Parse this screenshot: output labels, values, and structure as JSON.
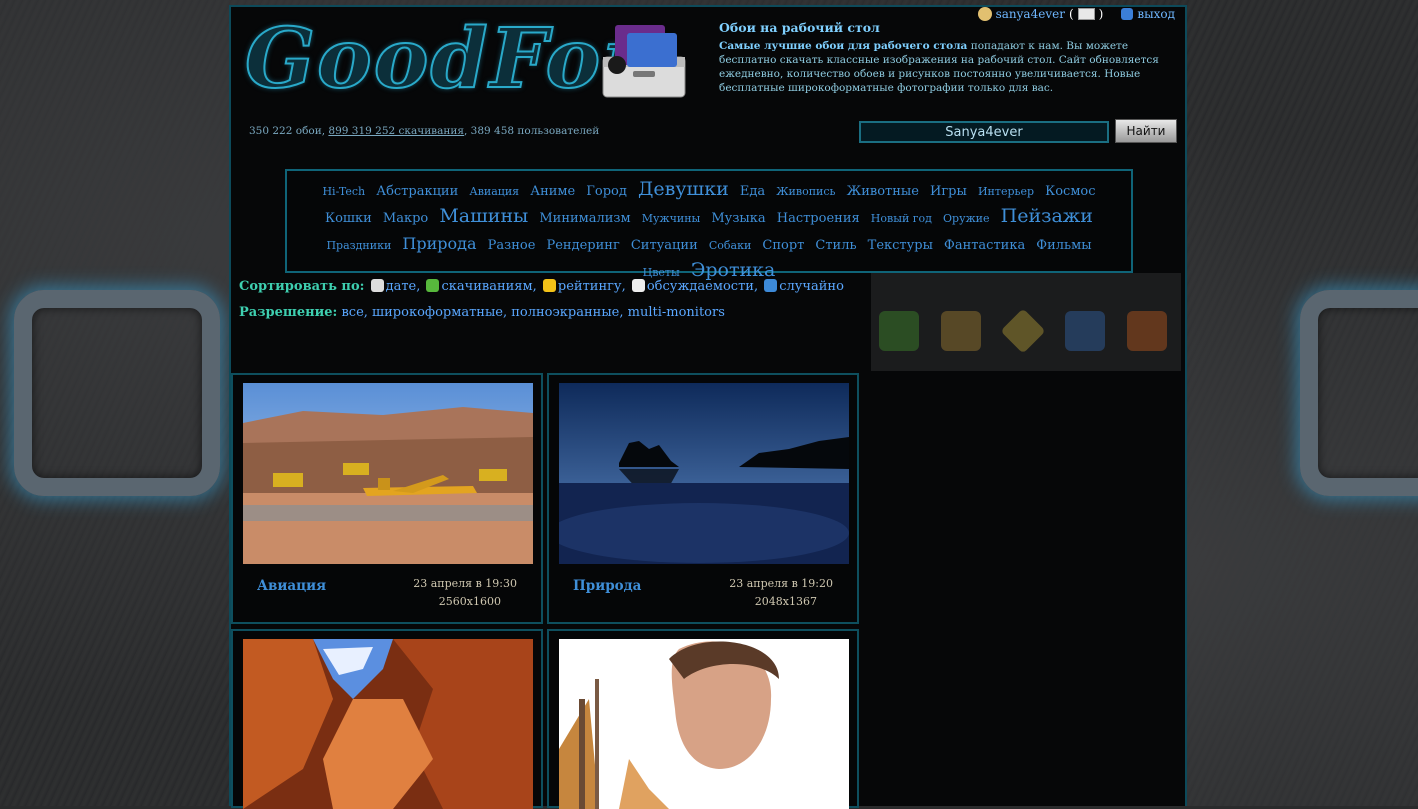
{
  "header": {
    "logo_text": "GoodFon",
    "user": {
      "name": "sanya4ever",
      "open_paren": "(",
      "close_paren": ")",
      "logout_label": "выход"
    },
    "intro": {
      "title": "Обои на рабочий стол",
      "bold_lead": "Самые лучшие обои для рабочего стола",
      "text": " попадают к нам. Вы можете бесплатно скачать классные изображения на рабочий стол. Сайт обновляется ежедневно, количество обоев и рисунков постоянно увеличивается. Новые бесплатные широкоформатные фотографии только для вас."
    },
    "stats": {
      "walls": "350 222 обои, ",
      "downloads": "899 319 252 скачивания",
      "users": ", 389 458 пользователей"
    },
    "search": {
      "value": "Sanya4ever",
      "button_label": "Найти"
    }
  },
  "tags": [
    {
      "label": "Hi-Tech",
      "size": "s1"
    },
    {
      "label": "Абстракции",
      "size": "s2"
    },
    {
      "label": "Авиация",
      "size": "s1"
    },
    {
      "label": "Аниме",
      "size": "s2"
    },
    {
      "label": "Город",
      "size": "s2"
    },
    {
      "label": "Девушки",
      "size": "s4"
    },
    {
      "label": "Еда",
      "size": "s2"
    },
    {
      "label": "Живопись",
      "size": "s1"
    },
    {
      "label": "Животные",
      "size": "s2"
    },
    {
      "label": "Игры",
      "size": "s2"
    },
    {
      "label": "Интерьер",
      "size": "s1"
    },
    {
      "label": "Космос",
      "size": "s2"
    },
    {
      "label": "Кошки",
      "size": "s2"
    },
    {
      "label": "Макро",
      "size": "s2"
    },
    {
      "label": "Машины",
      "size": "s4"
    },
    {
      "label": "Минимализм",
      "size": "s2"
    },
    {
      "label": "Мужчины",
      "size": "s1"
    },
    {
      "label": "Музыка",
      "size": "s2"
    },
    {
      "label": "Настроения",
      "size": "s2"
    },
    {
      "label": "Новый год",
      "size": "s1"
    },
    {
      "label": "Оружие",
      "size": "s1"
    },
    {
      "label": "Пейзажи",
      "size": "s4"
    },
    {
      "label": "Праздники",
      "size": "s1"
    },
    {
      "label": "Природа",
      "size": "s3"
    },
    {
      "label": "Разное",
      "size": "s2"
    },
    {
      "label": "Рендеринг",
      "size": "s2"
    },
    {
      "label": "Ситуации",
      "size": "s2"
    },
    {
      "label": "Собаки",
      "size": "s1"
    },
    {
      "label": "Спорт",
      "size": "s2"
    },
    {
      "label": "Стиль",
      "size": "s2"
    },
    {
      "label": "Текстуры",
      "size": "s2"
    },
    {
      "label": "Фантастика",
      "size": "s2"
    },
    {
      "label": "Фильмы",
      "size": "s2"
    },
    {
      "label": "Цветы",
      "size": "s1"
    },
    {
      "label": "Эротика",
      "size": "s4"
    }
  ],
  "sort": {
    "label": "Сортировать по:",
    "options": [
      {
        "label": "дате",
        "icon": "clock-icon",
        "color": "#dddddd"
      },
      {
        "label": "скачиваниям",
        "icon": "download-icon",
        "color": "#57b83c"
      },
      {
        "label": "рейтингу",
        "icon": "star-icon",
        "color": "#f3c218"
      },
      {
        "label": "обсуждаемости",
        "icon": "comment-icon",
        "color": "#eeeeee"
      },
      {
        "label": "случайно",
        "icon": "random-icon",
        "color": "#3d8ad8"
      }
    ]
  },
  "resolution": {
    "label": "Разрешение:",
    "options": [
      "все",
      "широкоформатные",
      "полноэкранные",
      "multi-monitors"
    ]
  },
  "cards": [
    {
      "category": "Авиация",
      "date": "23 апреля в 19:30",
      "res": "2560x1600",
      "image": "airplane-desert"
    },
    {
      "category": "Природа",
      "date": "23 апреля в 19:20",
      "res": "2048x1367",
      "image": "night-lake"
    },
    {
      "category": "",
      "date": "",
      "res": "",
      "image": "red-canyon"
    },
    {
      "category": "",
      "date": "",
      "res": "",
      "image": "girl-portrait"
    }
  ],
  "colors": {
    "accent": "#3f8fd8",
    "border": "#0f6478",
    "label_green": "#3ecfb0"
  }
}
